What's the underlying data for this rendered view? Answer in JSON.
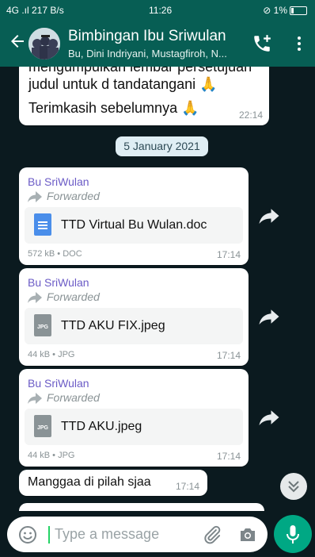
{
  "status_bar": {
    "signal": "4G .ıl 217 B/s",
    "time": "11:26",
    "battery": "⊘ 1%"
  },
  "header": {
    "title": "Bimbingan Ibu Sriwulan",
    "subtitle": "Bu, Dini Indriyani, Mustagfiroh, N..."
  },
  "messages": {
    "m1": {
      "line1": "mengumpulkan lembar persetujuan",
      "line2": "judul untuk d tandatangani 🙏",
      "line3": "Terimkasih sebelumnya 🙏",
      "time": "22:14"
    },
    "date_chip": "5 January 2021",
    "m2": {
      "sender": "Bu SriWulan",
      "forwarded": "Forwarded",
      "file_name": "TTD Virtual Bu Wulan.doc",
      "meta": "572 kB • DOC",
      "time": "17:14"
    },
    "m3": {
      "sender": "Bu SriWulan",
      "forwarded": "Forwarded",
      "file_type": "JPG",
      "file_name": "TTD AKU FIX.jpeg",
      "meta": "44 kB • JPG",
      "time": "17:14"
    },
    "m4": {
      "sender": "Bu SriWulan",
      "forwarded": "Forwarded",
      "file_type": "JPG",
      "file_name": "TTD AKU.jpeg",
      "meta": "44 kB • JPG",
      "time": "17:14"
    },
    "m5": {
      "text": "Manggaa di pilah sjaa",
      "time": "17:14"
    }
  },
  "input": {
    "placeholder": "Type a message"
  },
  "colors": {
    "header": "#075e54",
    "accent": "#00a884",
    "sender": "#6b5bc6"
  },
  "icons": [
    "back-arrow-icon",
    "group-avatar",
    "add-call-icon",
    "more-vert-icon",
    "forward-arrow-icon",
    "doc-file-icon",
    "jpg-file-icon",
    "share-icon",
    "chevron-double-down-icon",
    "emoji-icon",
    "attach-icon",
    "camera-icon",
    "mic-icon"
  ]
}
